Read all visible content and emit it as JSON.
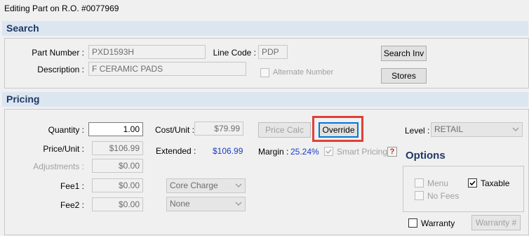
{
  "window": {
    "title": "Editing Part on R.O. #0077969"
  },
  "search": {
    "header": "Search",
    "part_number_label": "Part Number :",
    "part_number_value": "PXD1593H",
    "line_code_label": "Line Code :",
    "line_code_value": "PDP",
    "description_label": "Description :",
    "description_value": "F CERAMIC PADS",
    "alternate_number_label": "Alternate Number",
    "search_inv_label": "Search Inv",
    "stores_label": "Stores"
  },
  "pricing": {
    "header": "Pricing",
    "quantity_label": "Quantity :",
    "quantity_value": "1.00",
    "price_unit_label": "Price/Unit :",
    "price_unit_value": "$106.99",
    "adjustments_label": "Adjustments :",
    "adjustments_value": "$0.00",
    "fee1_label": "Fee1 :",
    "fee1_value": "$0.00",
    "fee2_label": "Fee2 :",
    "fee2_value": "$0.00",
    "cost_unit_label": "Cost/Unit :",
    "cost_unit_value": "$79.99",
    "extended_label": "Extended :",
    "extended_value": "$106.99",
    "core_charge_value": "Core Charge",
    "none_value": "None",
    "price_calc_label": "Price Calc",
    "override_label": "Override",
    "margin_label": "Margin :",
    "margin_value": "25.24%",
    "smart_pricing_label": "Smart Pricing",
    "help_label": "?",
    "level_label": "Level :",
    "level_value": "RETAIL"
  },
  "options": {
    "title": "Options",
    "menu_label": "Menu",
    "no_fees_label": "No Fees",
    "taxable_label": "Taxable",
    "taxable_checked": true,
    "warranty_label": "Warranty",
    "warranty_button_label": "Warranty #"
  },
  "colors": {
    "accent": "#1f3864",
    "highlight": "#e0403a",
    "value_blue": "#1a3cc4"
  }
}
